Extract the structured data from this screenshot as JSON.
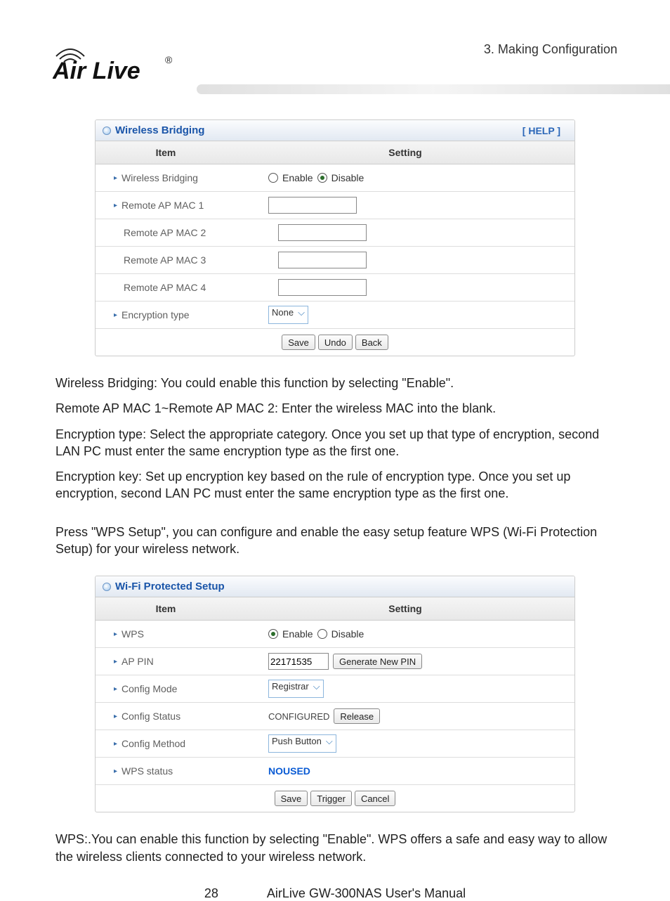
{
  "page": {
    "chapter": "3.  Making  Configuration",
    "number": "28",
    "manual_title": "AirLive GW-300NAS User's Manual",
    "logo": {
      "top": "Air Live",
      "trademark": "®"
    }
  },
  "panel1": {
    "title": "Wireless Bridging",
    "help": "[ HELP ]",
    "header_item": "Item",
    "header_setting": "Setting",
    "rows": {
      "bridging_label": "Wireless Bridging",
      "bridging_enable": "Enable",
      "bridging_disable": "Disable",
      "bridging_selected": "disable",
      "mac1_label": "Remote AP MAC  1",
      "mac1_value": "",
      "mac2_label": "Remote AP MAC  2",
      "mac2_value": "",
      "mac3_label": "Remote AP MAC  3",
      "mac3_value": "",
      "mac4_label": "Remote AP MAC  4",
      "mac4_value": "",
      "enc_label": "Encryption type",
      "enc_value": "None"
    },
    "buttons": {
      "save": "Save",
      "undo": "Undo",
      "back": "Back"
    }
  },
  "paragraphs": {
    "p1": "Wireless Bridging: You could enable this function by selecting \"Enable\".",
    "p2": "Remote AP MAC 1~Remote AP MAC 2: Enter the wireless MAC into the blank.",
    "p3": "Encryption type: Select the appropriate category. Once you set up that type of encryption, second LAN PC must enter the same encryption type as the first one.",
    "p4": "Encryption key: Set up encryption key based on the rule of encryption type. Once you set up encryption, second LAN PC must enter the same encryption type as the first one.",
    "p5": "Press \"WPS Setup\", you can configure and enable the easy setup feature WPS (Wi-Fi Protection Setup) for your wireless network.",
    "p6": "WPS:.You can enable this function by selecting \"Enable\". WPS offers a safe and easy way to allow the wireless clients connected to your wireless network."
  },
  "panel2": {
    "title": "Wi-Fi Protected Setup",
    "header_item": "Item",
    "header_setting": "Setting",
    "rows": {
      "wps_label": "WPS",
      "wps_enable": "Enable",
      "wps_disable": "Disable",
      "wps_selected": "enable",
      "pin_label": "AP PIN",
      "pin_value": "22171535",
      "pin_button": "Generate New PIN",
      "mode_label": "Config Mode",
      "mode_value": "Registrar",
      "status_label": "Config Status",
      "status_value": "CONFIGURED",
      "status_button": "Release",
      "method_label": "Config Method",
      "method_value": "Push Button",
      "wpsstatus_label": "WPS status",
      "wpsstatus_value": "NOUSED"
    },
    "buttons": {
      "save": "Save",
      "trigger": "Trigger",
      "cancel": "Cancel"
    }
  }
}
